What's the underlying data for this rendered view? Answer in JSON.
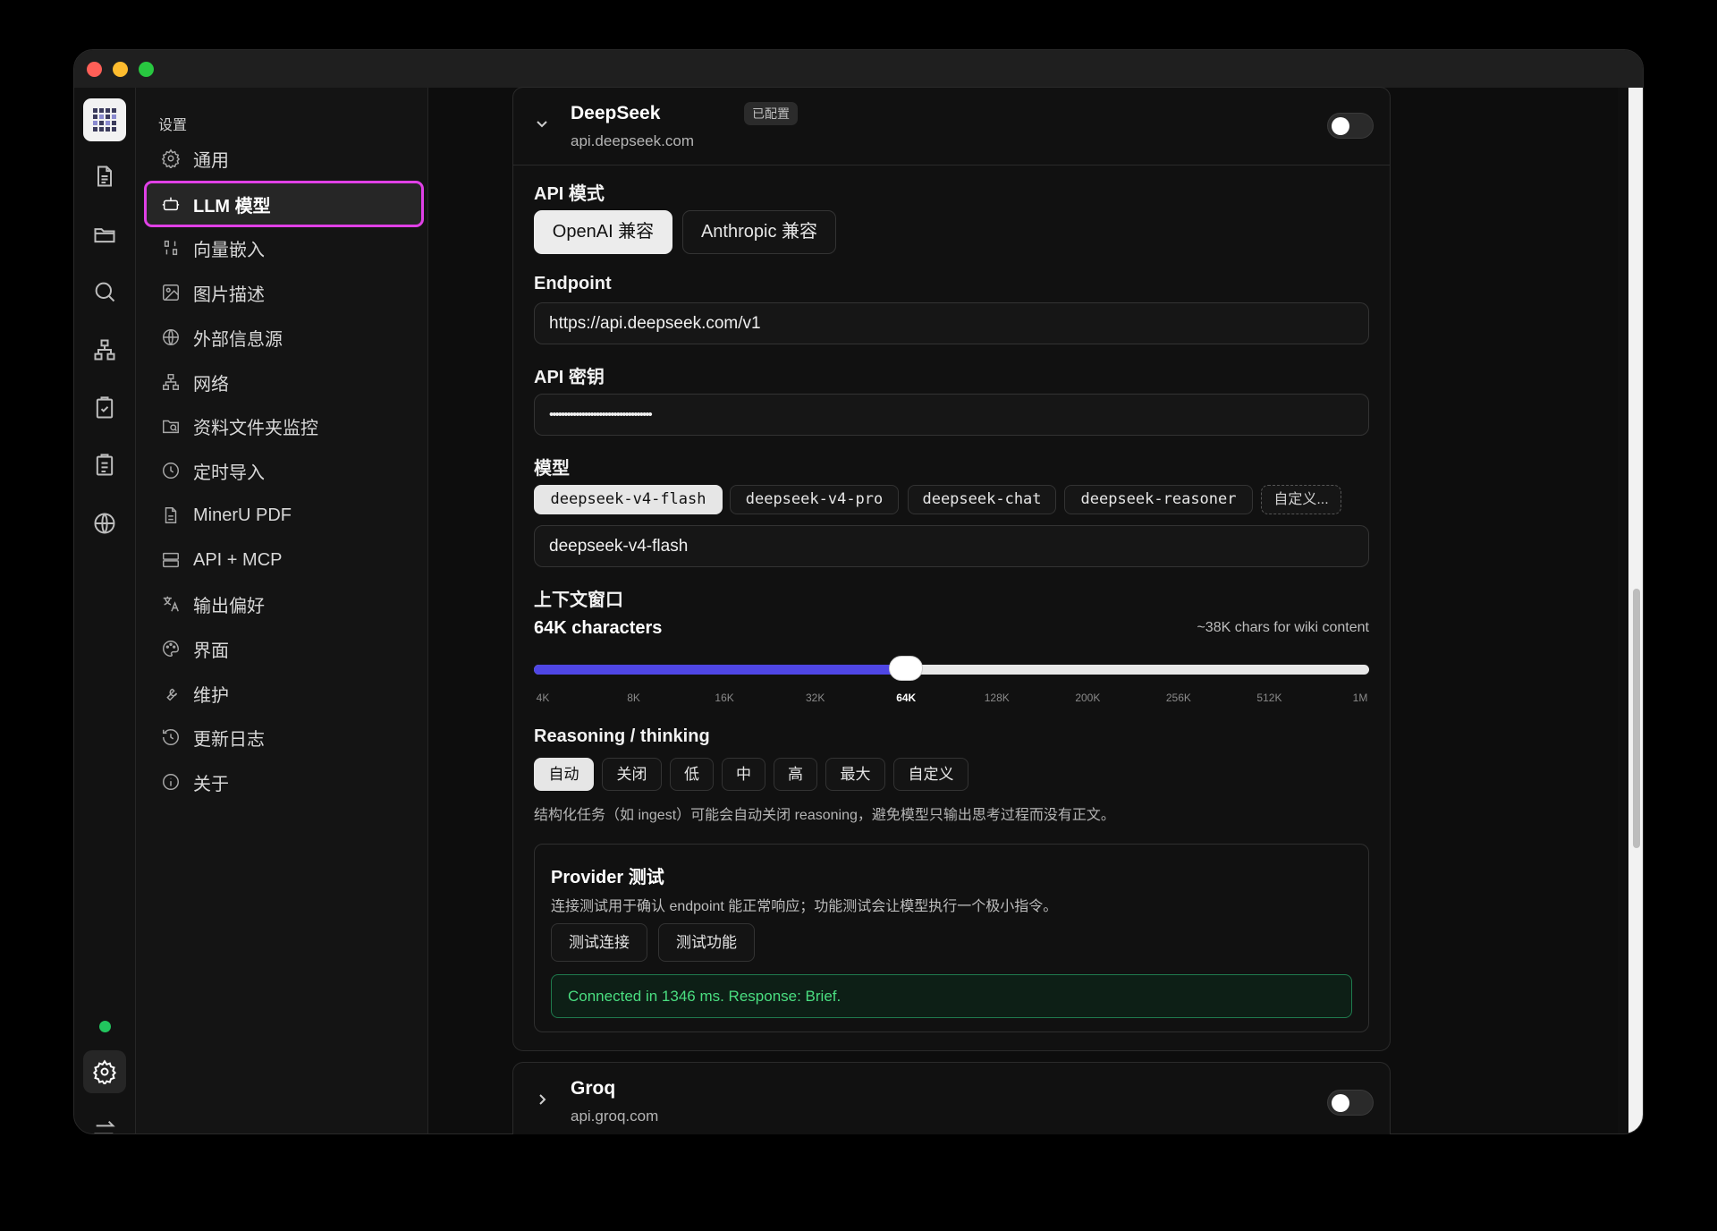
{
  "colors": {
    "accent": "#4f46e5",
    "active_outline": "#e040e6",
    "success": "#22c55e"
  },
  "rail": {
    "icons": [
      "app-logo-icon",
      "document-icon",
      "folder-icon",
      "search-icon",
      "sitemap-icon",
      "clipboard-check-icon",
      "clipboard-list-icon",
      "globe-icon",
      "gear-icon",
      "swap-icon"
    ]
  },
  "sidebar": {
    "heading": "设置",
    "items": [
      {
        "label": "通用",
        "icon": "gear-icon"
      },
      {
        "label": "LLM 模型",
        "icon": "robot-icon",
        "active": true
      },
      {
        "label": "向量嵌入",
        "icon": "vector-icon"
      },
      {
        "label": "图片描述",
        "icon": "image-icon"
      },
      {
        "label": "外部信息源",
        "icon": "globe-icon"
      },
      {
        "label": "网络",
        "icon": "network-icon"
      },
      {
        "label": "资料文件夹监控",
        "icon": "folder-search-icon"
      },
      {
        "label": "定时导入",
        "icon": "clock-icon"
      },
      {
        "label": "MinerU PDF",
        "icon": "file-icon"
      },
      {
        "label": "API + MCP",
        "icon": "server-icon"
      },
      {
        "label": "输出偏好",
        "icon": "translate-icon"
      },
      {
        "label": "界面",
        "icon": "palette-icon"
      },
      {
        "label": "维护",
        "icon": "wrench-icon"
      },
      {
        "label": "更新日志",
        "icon": "history-icon"
      },
      {
        "label": "关于",
        "icon": "info-icon"
      }
    ]
  },
  "deepseek": {
    "name": "DeepSeek",
    "badge": "已配置",
    "host": "api.deepseek.com",
    "enabled": false,
    "api_mode_label": "API 模式",
    "api_modes": [
      "OpenAI 兼容",
      "Anthropic 兼容"
    ],
    "api_mode_selected": "OpenAI 兼容",
    "endpoint_label": "Endpoint",
    "endpoint_value": "https://api.deepseek.com/v1",
    "api_key_label": "API 密钥",
    "api_key_value": "•••••••••••••••••••••••••••••••••••",
    "model_label": "模型",
    "model_chips": [
      "deepseek-v4-flash",
      "deepseek-v4-pro",
      "deepseek-chat",
      "deepseek-reasoner"
    ],
    "model_custom_chip": "自定义...",
    "model_value": "deepseek-v4-flash",
    "context_label": "上下文窗口",
    "context_value": "64K characters",
    "context_note": "~38K chars for wiki content",
    "context_ticks": [
      "4K",
      "8K",
      "16K",
      "32K",
      "64K",
      "128K",
      "200K",
      "256K",
      "512K",
      "1M"
    ],
    "context_selected_index": 4,
    "reasoning_label": "Reasoning / thinking",
    "reasoning_options": [
      "自动",
      "关闭",
      "低",
      "中",
      "高",
      "最大",
      "自定义"
    ],
    "reasoning_selected": "自动",
    "reasoning_hint": "结构化任务（如 ingest）可能会自动关闭 reasoning，避免模型只输出思考过程而没有正文。",
    "test": {
      "title": "Provider 测试",
      "desc": "连接测试用于确认 endpoint 能正常响应；功能测试会让模型执行一个极小指令。",
      "btn_connection": "测试连接",
      "btn_function": "测试功能",
      "result": "Connected in 1346 ms. Response: Brief."
    }
  },
  "groq": {
    "name": "Groq",
    "host": "api.groq.com",
    "enabled": false
  }
}
